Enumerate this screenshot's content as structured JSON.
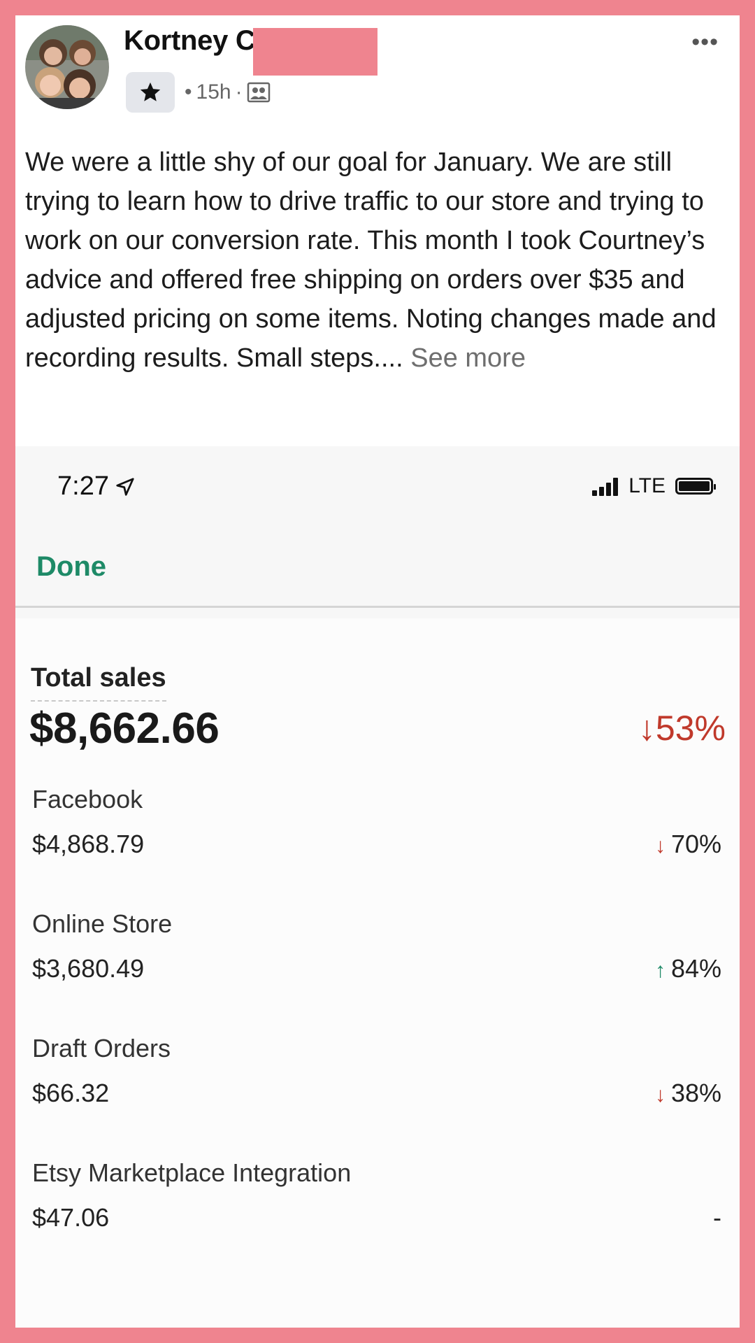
{
  "post": {
    "author": "Kortney C",
    "time": "15h",
    "separator_1": "•",
    "separator_2": "·",
    "more_icon": "more-dots-icon",
    "text": "We were a little shy of our goal for January. We are still trying to learn how to drive traffic to our store and trying to work on our conversion rate. This month I took Courtney’s advice and offered free shipping on orders over $35 and adjusted pricing on some items. Noting changes made and recording results. Small steps.... ",
    "see_more": "See more"
  },
  "phone": {
    "status_time": "7:27",
    "network": "LTE",
    "done_label": "Done"
  },
  "report": {
    "total_label": "Total sales",
    "total_value": "$8,662.66",
    "total_change": "53%",
    "total_direction": "down",
    "channels": [
      {
        "name": "Facebook",
        "value": "$4,868.79",
        "change": "70%",
        "direction": "down"
      },
      {
        "name": "Online Store",
        "value": "$3,680.49",
        "change": "84%",
        "direction": "up"
      },
      {
        "name": "Draft Orders",
        "value": "$66.32",
        "change": "38%",
        "direction": "down"
      },
      {
        "name": "Etsy Marketplace Integration",
        "value": "$47.06",
        "change": "-",
        "direction": "none"
      }
    ]
  },
  "colors": {
    "border_pink": "#ef848f",
    "done_green": "#1e8a67",
    "down_red": "#c0392b",
    "up_green": "#1e8a67"
  }
}
